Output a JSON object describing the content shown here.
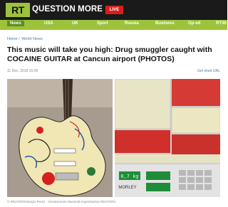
{
  "header": {
    "logo": "RT",
    "brand": "QUESTION MORE",
    "live_label": "LIVE"
  },
  "nav": [
    {
      "label": "News"
    },
    {
      "label": "USA"
    },
    {
      "label": "UK"
    },
    {
      "label": "Sport"
    },
    {
      "label": "Russia"
    },
    {
      "label": "Business"
    },
    {
      "label": "Op-ed"
    },
    {
      "label": "RT36"
    }
  ],
  "breadcrumb": {
    "home": "Home",
    "section": "World News"
  },
  "article": {
    "title": "This music will take you high: Drug smuggler caught with COCAINE GUITAR at Cancun airport (PHOTOS)",
    "date": "11 Dec, 2018 15:59",
    "short_url": "Get short URL",
    "caption": "© REUTERS/Sergio Perez · Gendarmeria Nacional Argentina/via REUTERS",
    "scale_readout": "0,7 kg",
    "scale_brand": "MORLEY"
  },
  "colors": {
    "brand_green": "#9dc23b",
    "live_red": "#d6201f",
    "topbar": "#1a1a1a"
  }
}
